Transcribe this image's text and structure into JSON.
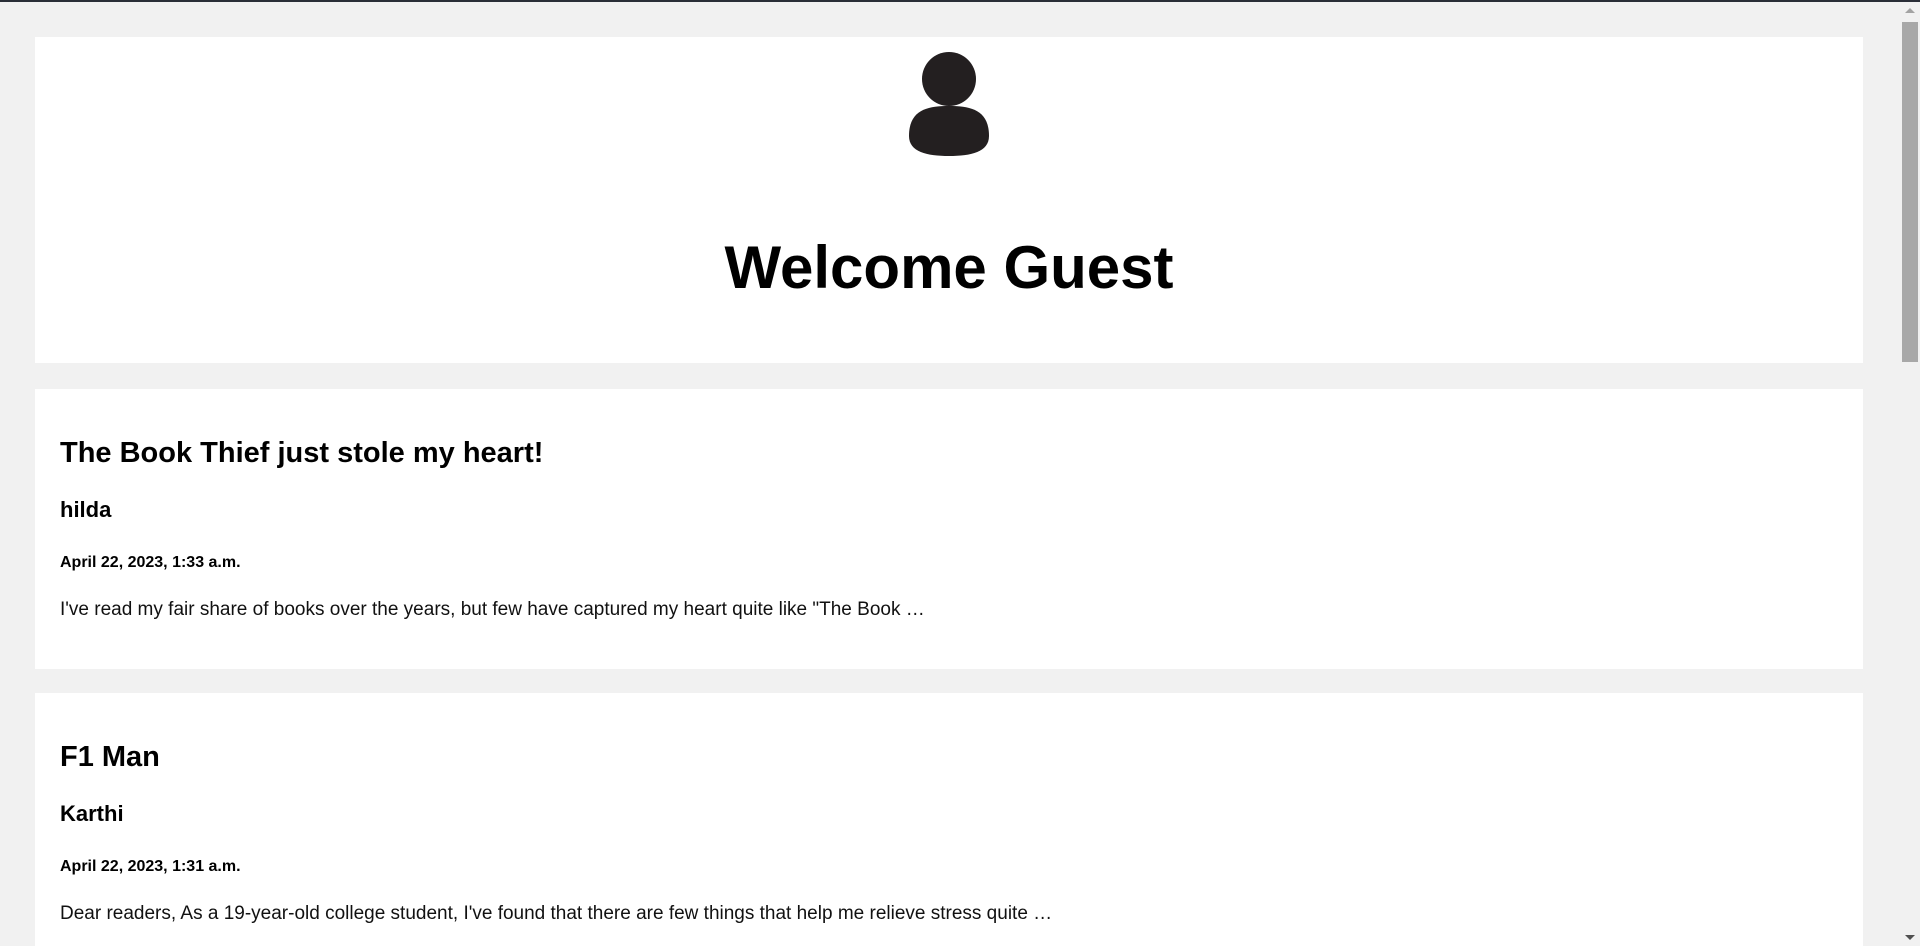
{
  "header": {
    "welcome": "Welcome Guest",
    "avatar_icon": "user-icon"
  },
  "posts": [
    {
      "title": "The Book Thief just stole my heart!",
      "author": "hilda",
      "date": "April 22, 2023, 1:33 a.m.",
      "excerpt": "I've read my fair share of books over the years, but few have captured my heart quite like \"The Book …"
    },
    {
      "title": "F1 Man",
      "author": "Karthi",
      "date": "April 22, 2023, 1:31 a.m.",
      "excerpt": "Dear readers, As a 19-year-old college student, I've found that there are few things that help me relieve stress quite …"
    }
  ],
  "colors": {
    "page_background": "#f1f1f1",
    "card_background": "#ffffff",
    "avatar": "#231f20"
  }
}
